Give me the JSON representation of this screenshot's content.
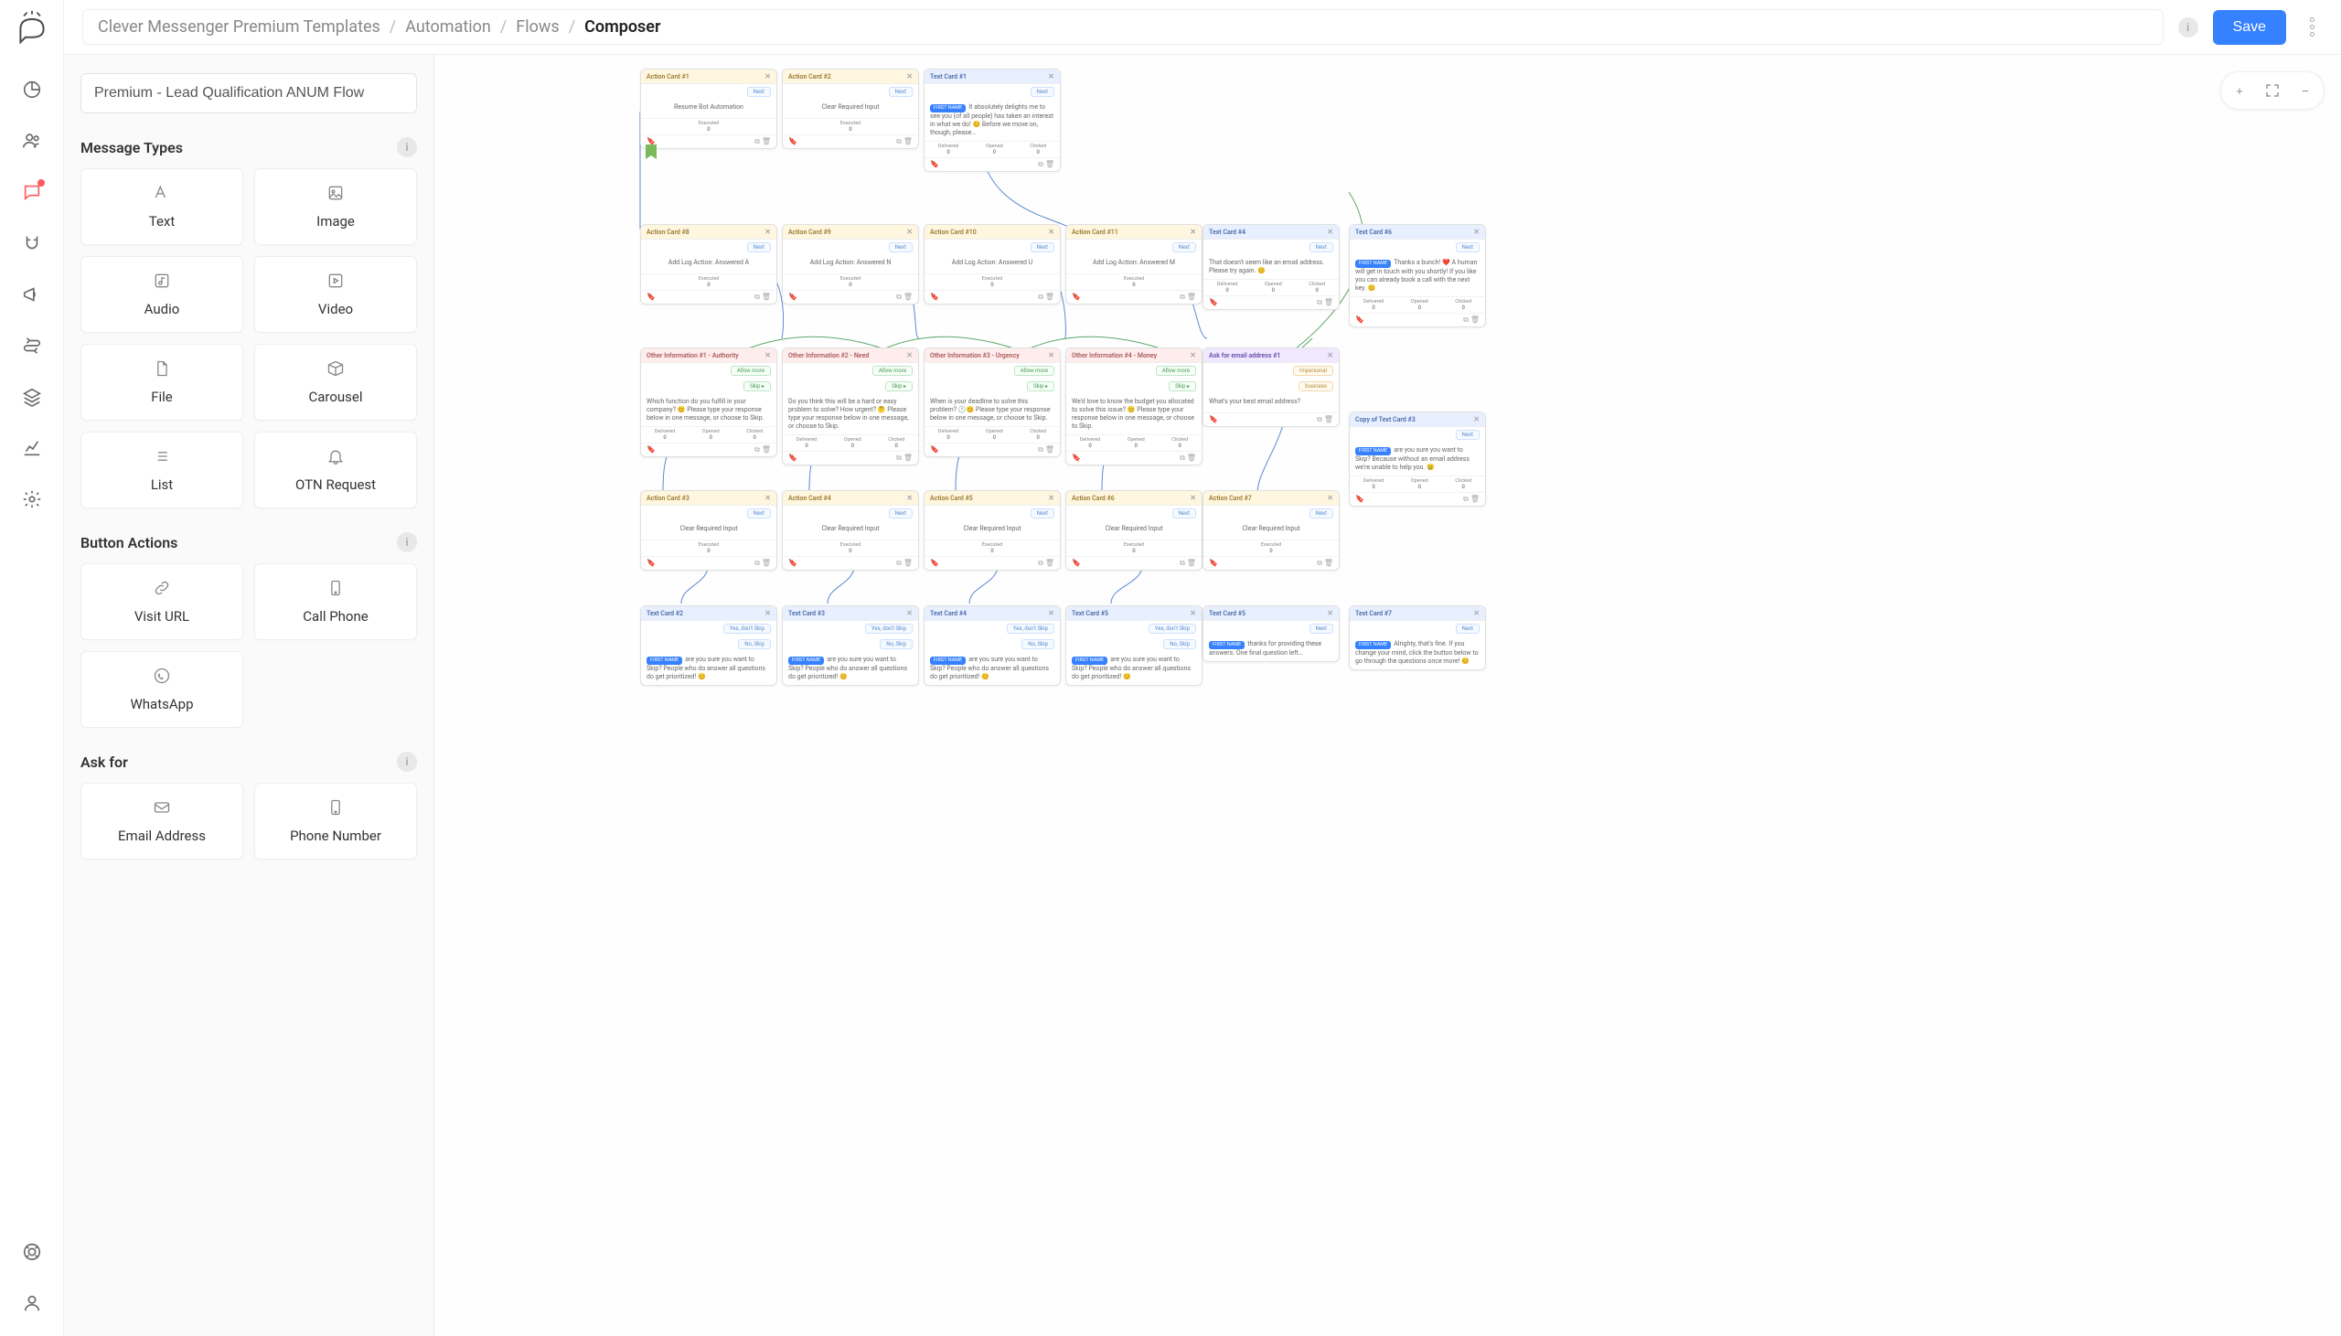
{
  "breadcrumb": {
    "items": [
      "Clever Messenger Premium Templates",
      "Automation",
      "Flows",
      "Composer"
    ]
  },
  "save": "Save",
  "flow_name": "Premium - Lead Qualification ANUM Flow",
  "sections": {
    "message_types": "Message Types",
    "button_actions": "Button Actions",
    "ask_for": "Ask for"
  },
  "palette": {
    "text": "Text",
    "image": "Image",
    "audio": "Audio",
    "video": "Video",
    "file": "File",
    "carousel": "Carousel",
    "list": "List",
    "otn": "OTN Request",
    "visit_url": "Visit URL",
    "call_phone": "Call Phone",
    "whatsapp": "WhatsApp",
    "email": "Email Address",
    "phone": "Phone Number"
  },
  "zoom": {
    "plus": "+",
    "fit": "⤧",
    "minus": "−"
  },
  "stats": {
    "executed": "Executed",
    "delivered": "Delivered",
    "opened": "Opened",
    "clicked": "Clicked",
    "zero": "0"
  },
  "pills": {
    "next": "Next",
    "allow_more": "Allow more",
    "skip": "Skip ▸",
    "yes_dont_skip": "Yes, don't Skip",
    "no_skip": "No, Skip",
    "impersonal": "Impersonal",
    "business": "business"
  },
  "chip": {
    "first_name": "FIRST NAME"
  },
  "nodes": {
    "a1": {
      "title": "Action Card #1",
      "body": "Resume Bot Automation"
    },
    "a2": {
      "title": "Action Card #2",
      "body": "Clear Required Input"
    },
    "t1": {
      "title": "Text Card #1",
      "body": "It absolutely delights me to see you (of all people) has taken an interest in what we do! 😊 Before we move on, though, please…"
    },
    "a8": {
      "title": "Action Card #8",
      "body": "Add Log Action: Answered A"
    },
    "a9": {
      "title": "Action Card #9",
      "body": "Add Log Action: Answered N"
    },
    "a10": {
      "title": "Action Card #10",
      "body": "Add Log Action: Answered U"
    },
    "a11": {
      "title": "Action Card #11",
      "body": "Add Log Action: Answered M"
    },
    "t4": {
      "title": "Text Card #4",
      "body": "That doesn't seem like an email address. Please try again. 😊"
    },
    "t6": {
      "title": "Text Card #6",
      "body": "Thanks a bunch! ❤️ A human will get in touch with you shortly! If you like you can already book a call with the next key. 😊"
    },
    "o1": {
      "title": "Other Information #1 - Authority",
      "body": "Which function do you fulfill in your company? 😊 Please type your response below in one message, or choose to Skip."
    },
    "o2": {
      "title": "Other Information #2 - Need",
      "body": "Do you think this will be a hard or easy problem to solve? How urgent? 🤔 Please type your response below in one message, or choose to Skip."
    },
    "o3": {
      "title": "Other Information #3 - Urgency",
      "body": "When is your deadline to solve this problem? 🕐😊 Please type your response below in one message, or choose to Skip."
    },
    "o4": {
      "title": "Other Information #4 - Money",
      "body": "We'd love to know the budget you allocated to solve this issue? 😊 Please type your response below in one message, or choose to Skip."
    },
    "ask": {
      "title": "Ask for email address #1",
      "body": "What's your best email address?"
    },
    "a3": {
      "title": "Action Card #3",
      "body": "Clear Required Input"
    },
    "a4": {
      "title": "Action Card #4",
      "body": "Clear Required Input"
    },
    "a5": {
      "title": "Action Card #5",
      "body": "Clear Required Input"
    },
    "a6": {
      "title": "Action Card #6",
      "body": "Clear Required Input"
    },
    "a7": {
      "title": "Action Card #7",
      "body": "Clear Required Input"
    },
    "t2": {
      "title": "Text Card #2",
      "body": "are you sure you want to Skip? People who do answer all questions do get prioritized! 😊"
    },
    "t3": {
      "title": "Text Card #3",
      "body": "are you sure you want to Skip? People who do answer all questions do get prioritized! 😊"
    },
    "t4b": {
      "title": "Text Card #4",
      "body": "are you sure you want to Skip? People who do answer all questions do get prioritized! 😊"
    },
    "t5": {
      "title": "Text Card #5",
      "body": "are you sure you want to Skip? People who do answer all questions do get prioritized! 😊"
    },
    "t5b": {
      "title": "Text Card #5",
      "body": "thanks for providing these answers. One final question left…"
    },
    "t7": {
      "title": "Text Card #7",
      "body": "Alrighty, that's fine. If you change your mind, click the button below to go through the questions once more! 😊"
    },
    "ct3": {
      "title": "Copy of Text Card #3",
      "body": "are you sure you want to Skip? Because without an email address we're unable to help you. 😢"
    }
  }
}
